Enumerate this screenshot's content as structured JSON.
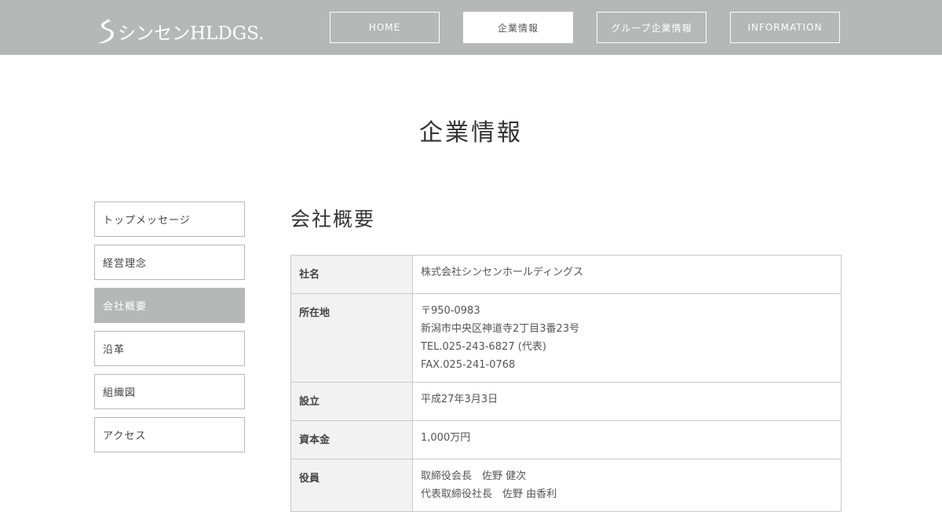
{
  "header": {
    "logo_text": "シンセンHLDGS.",
    "nav": [
      {
        "label": "HOME",
        "active": false
      },
      {
        "label": "企業情報",
        "active": true
      },
      {
        "label": "グループ企業情報",
        "active": false
      },
      {
        "label": "INFORMATION",
        "active": false
      }
    ]
  },
  "page": {
    "title": "企業情報"
  },
  "sidebar": {
    "items": [
      {
        "label": "トップメッセージ",
        "active": false
      },
      {
        "label": "経営理念",
        "active": false
      },
      {
        "label": "会社概要",
        "active": true
      },
      {
        "label": "沿革",
        "active": false
      },
      {
        "label": "組織図",
        "active": false
      },
      {
        "label": "アクセス",
        "active": false
      }
    ]
  },
  "section": {
    "title": "会社概要"
  },
  "company_table": {
    "rows": [
      {
        "label": "社名",
        "lines": [
          "株式会社シンセンホールディングス"
        ]
      },
      {
        "label": "所在地",
        "lines": [
          "〒950-0983",
          "新潟市中央区神道寺2丁目3番23号",
          "TEL.025-243-6827 (代表)",
          "FAX.025-241-0768"
        ]
      },
      {
        "label": "設立",
        "lines": [
          "平成27年3月3日"
        ]
      },
      {
        "label": "資本金",
        "lines": [
          "1,000万円"
        ]
      },
      {
        "label": "役員",
        "lines": [
          "取締役会長　佐野 健次",
          "代表取締役社長　佐野 由香利"
        ]
      }
    ]
  },
  "colors": {
    "header_bg": "#b6b7b7",
    "active_bg": "#b6b7b7",
    "table_label_bg": "#f2f2f2",
    "border": "#c9c9c9"
  },
  "icons": {
    "logo": "swirl-s-logo-icon"
  }
}
